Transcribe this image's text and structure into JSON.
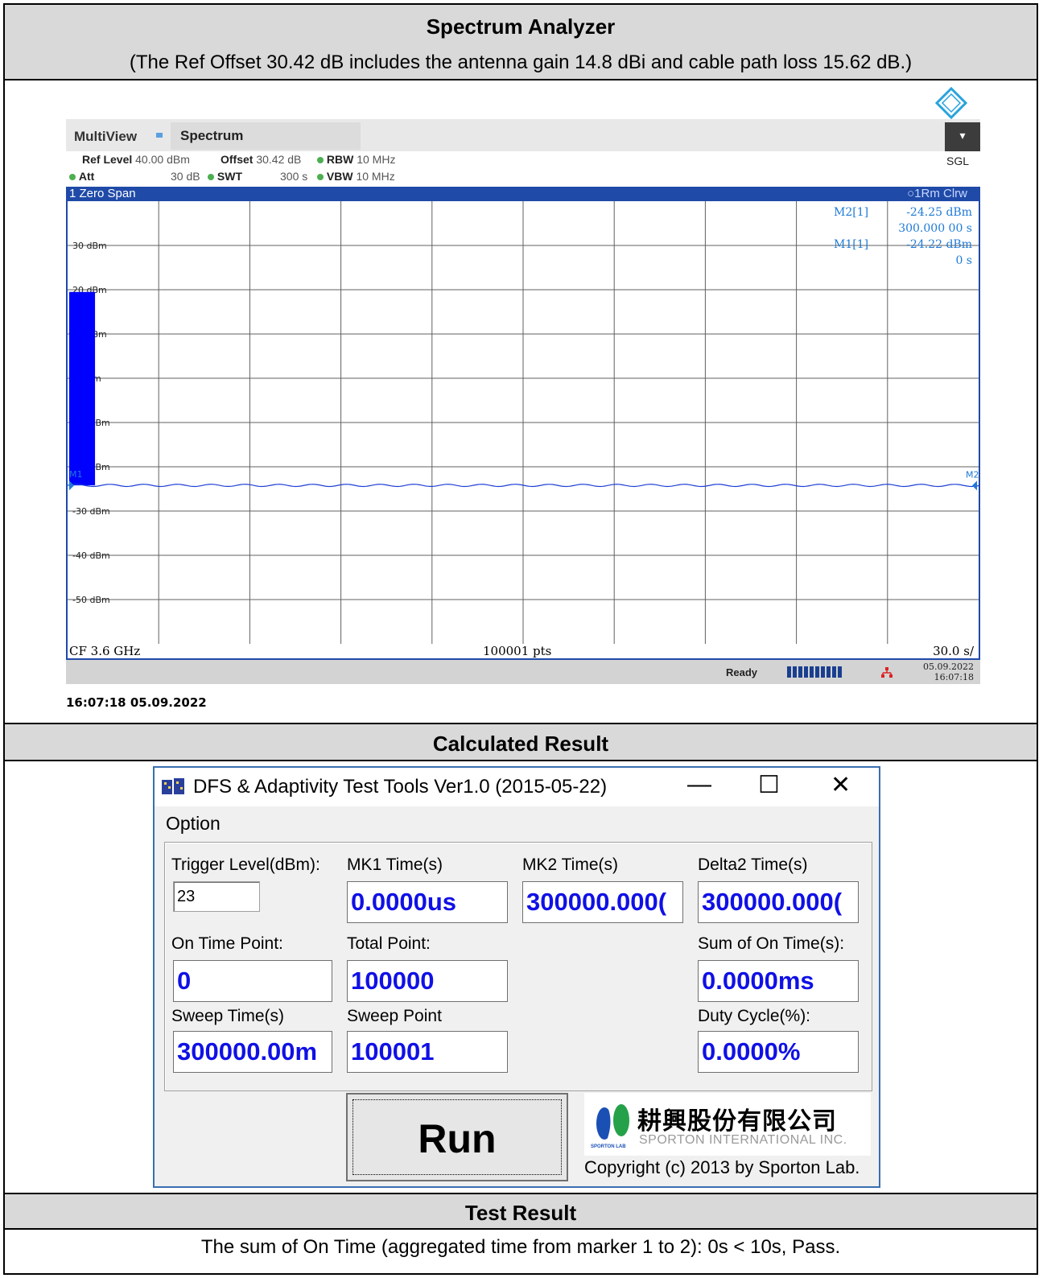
{
  "sections": {
    "analyzer_title": "Spectrum Analyzer",
    "analyzer_note": "(The Ref Offset 30.42 dB includes the antenna gain 14.8 dBi and cable path loss 15.62 dB.)",
    "calc_title": "Calculated Result",
    "test_title": "Test Result",
    "test_text": "The sum of On Time (aggregated time from marker 1 to 2): 0s < 10s, Pass."
  },
  "analyzer": {
    "tab_multiview": "MultiView",
    "tab_spectrum": "Spectrum",
    "sgl": "SGL",
    "ref_level_label": "Ref Level",
    "ref_level_value": "40.00 dBm",
    "offset_label": "Offset",
    "offset_value": "30.42 dB",
    "rbw_label": "RBW",
    "rbw_value": "10 MHz",
    "att_label": "Att",
    "att_value": "30 dB",
    "swt_label": "SWT",
    "swt_value": "300 s",
    "vbw_label": "VBW",
    "vbw_value": "10 MHz",
    "window_title": "1 Zero Span",
    "trace_mode": "1Rm Clrw",
    "m2_label": "M2[1]",
    "m2_level": "-24.25 dBm",
    "m2_time": "300.000 00 s",
    "m1_label": "M1[1]",
    "m1_level": "-24.22 dBm",
    "m1_time": "0 s",
    "y_ticks": [
      "30 dBm",
      "20 dBm",
      "10 dBm",
      "0 dBm",
      "-10 dBm",
      "-20 dBm",
      "-30 dBm",
      "-40 dBm",
      "-50 dBm"
    ],
    "marker_left": "M1",
    "marker_right": "M2",
    "cf": "CF 3.6 GHz",
    "points": "100001 pts",
    "time_div": "30.0 s/",
    "status_ready": "Ready",
    "status_date": "05.09.2022",
    "status_time": "16:07:18",
    "timestamp": "16:07:18  05.09.2022"
  },
  "chart_data": {
    "type": "line",
    "title": "1 Zero Span",
    "xlabel": "",
    "ylabel": "",
    "x_unit": "s",
    "xlim": [
      0,
      300
    ],
    "ylim": [
      -60,
      40
    ],
    "y_ticks": [
      30,
      20,
      10,
      0,
      -10,
      -20,
      -30,
      -40,
      -50
    ],
    "grid": true,
    "series": [
      {
        "name": "1Rm Clrw",
        "x": [
          0,
          300
        ],
        "y": [
          -24.2,
          -24.2
        ]
      }
    ],
    "markers": [
      {
        "name": "M1",
        "x": 0,
        "y": -24.22
      },
      {
        "name": "M2",
        "x": 300,
        "y": -24.25
      }
    ],
    "bar_region": {
      "x_start": 0,
      "x_end": 8.5,
      "y_top": 19.5
    },
    "colors": {
      "trace": "#1d3fd6",
      "fill": "#0000ff",
      "title_bar": "#1f4aa8",
      "grid": "#606060"
    }
  },
  "tool": {
    "title": "DFS & Adaptivity Test Tools Ver1.0 (2015-05-22)",
    "minimize": "—",
    "maximize": "☐",
    "close": "✕",
    "menu_option": "Option",
    "trigger_label": "Trigger Level(dBm):",
    "trigger_value": "23",
    "mk1_label": "MK1 Time(s)",
    "mk1_value": "0.0000us",
    "mk2_label": "MK2 Time(s)",
    "mk2_value": "300000.000(",
    "delta2_label": "Delta2 Time(s)",
    "delta2_value": "300000.000(",
    "on_point_label": "On Time Point:",
    "on_point_value": "0",
    "total_point_label": "Total Point:",
    "total_point_value": "100000",
    "sum_on_label": "Sum of On Time(s):",
    "sum_on_value": "0.0000ms",
    "sweep_time_label": "Sweep Time(s)",
    "sweep_time_value": "300000.00m",
    "sweep_point_label": "Sweep Point",
    "sweep_point_value": "100001",
    "duty_label": "Duty Cycle(%):",
    "duty_value": "0.0000%",
    "run_label": "Run",
    "logo_cn": "耕興股份有限公司",
    "logo_en": "SPORTON INTERNATIONAL INC.",
    "logo_small": "SPORTON LAB",
    "copyright": "Copyright (c) 2013 by Sporton Lab."
  }
}
